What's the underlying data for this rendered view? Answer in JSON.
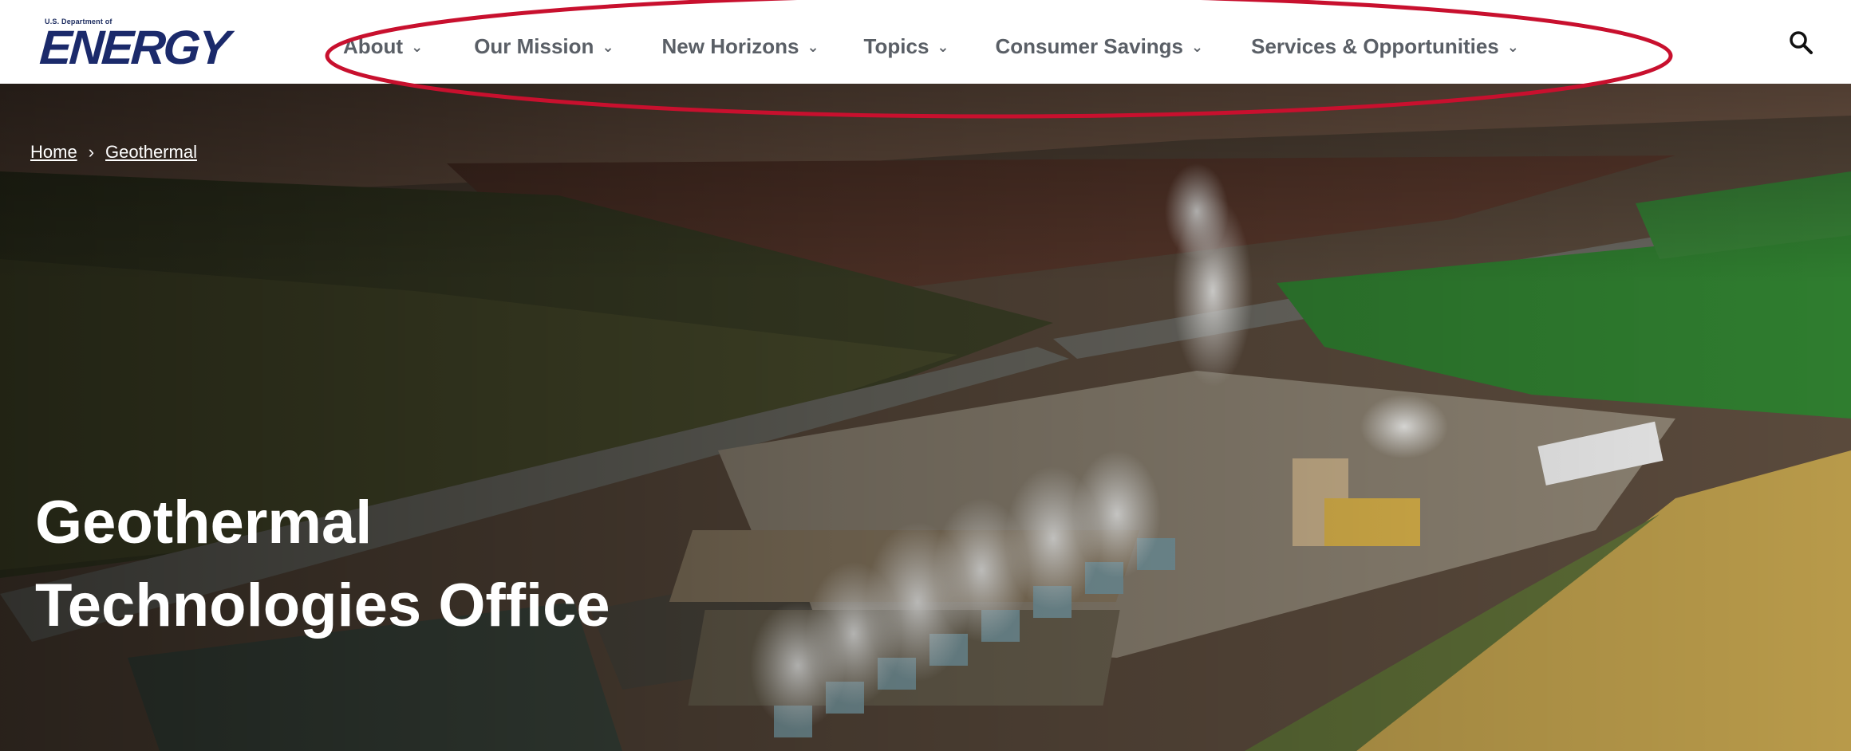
{
  "logo": {
    "small_text": "U.S. Department of",
    "word": "ENERGY",
    "bar_colors": [
      "#f5a623",
      "#22a6d8",
      "#8cc63f"
    ]
  },
  "nav": {
    "items": [
      {
        "label": "About"
      },
      {
        "label": "Our Mission"
      },
      {
        "label": "New Horizons"
      },
      {
        "label": "Topics"
      },
      {
        "label": "Consumer Savings"
      },
      {
        "label": "Services & Opportunities"
      }
    ],
    "chevron": "⌄"
  },
  "breadcrumb": {
    "home": "Home",
    "separator": "›",
    "current": "Geothermal"
  },
  "hero": {
    "title_line1": "Geothermal",
    "title_line2": "Technologies Office"
  },
  "icons": {
    "search": "search-icon"
  },
  "colors": {
    "annotation": "#c8102e",
    "nav_text": "#5a5f66",
    "logo_navy": "#1b2a6b"
  }
}
